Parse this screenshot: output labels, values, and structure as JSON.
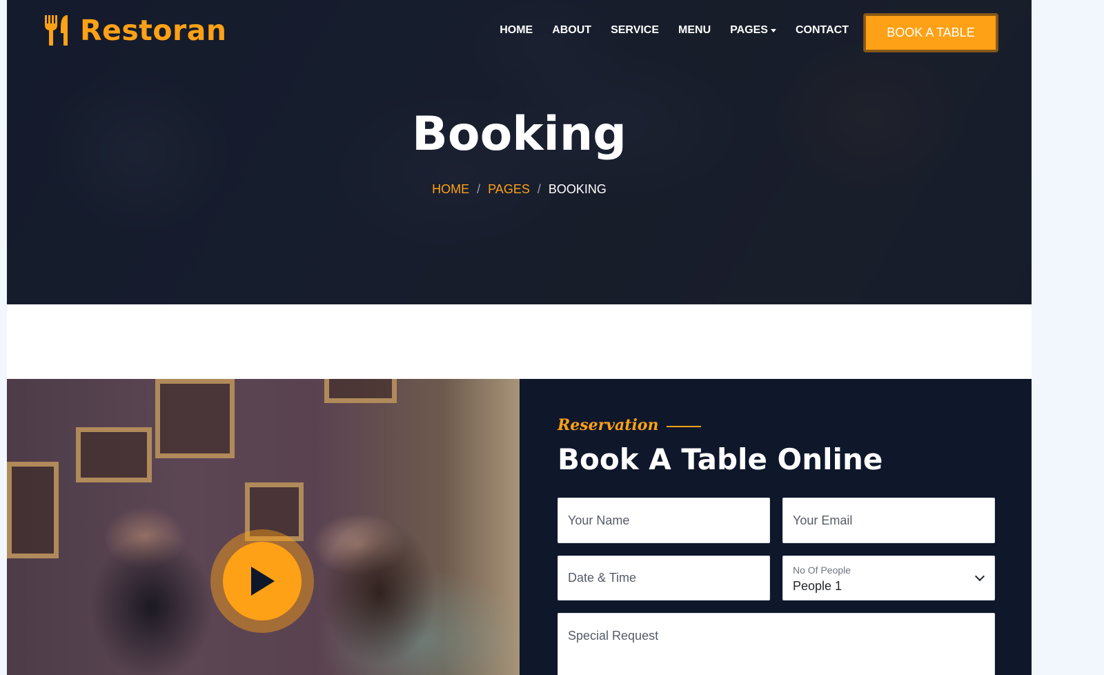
{
  "brand": {
    "name": "Restoran",
    "icon": "utensils-icon",
    "color": "#fea116"
  },
  "nav": {
    "items": [
      {
        "label": "HOME"
      },
      {
        "label": "ABOUT"
      },
      {
        "label": "SERVICE"
      },
      {
        "label": "MENU"
      },
      {
        "label": "PAGES",
        "dropdown": true
      },
      {
        "label": "CONTACT"
      }
    ],
    "cta_label": "BOOK A TABLE"
  },
  "hero": {
    "title": "Booking",
    "breadcrumb": [
      "HOME",
      "PAGES",
      "BOOKING"
    ]
  },
  "reservation": {
    "tag": "Reservation",
    "title": "Book A Table Online",
    "fields": {
      "name_placeholder": "Your Name",
      "email_placeholder": "Your Email",
      "datetime_placeholder": "Date & Time",
      "people_label": "No Of People",
      "people_value": "People 1",
      "request_placeholder": "Special Request"
    }
  },
  "video": {
    "play_icon": "play-icon"
  },
  "colors": {
    "accent": "#fea116",
    "dark": "#0f172b",
    "white": "#ffffff"
  }
}
